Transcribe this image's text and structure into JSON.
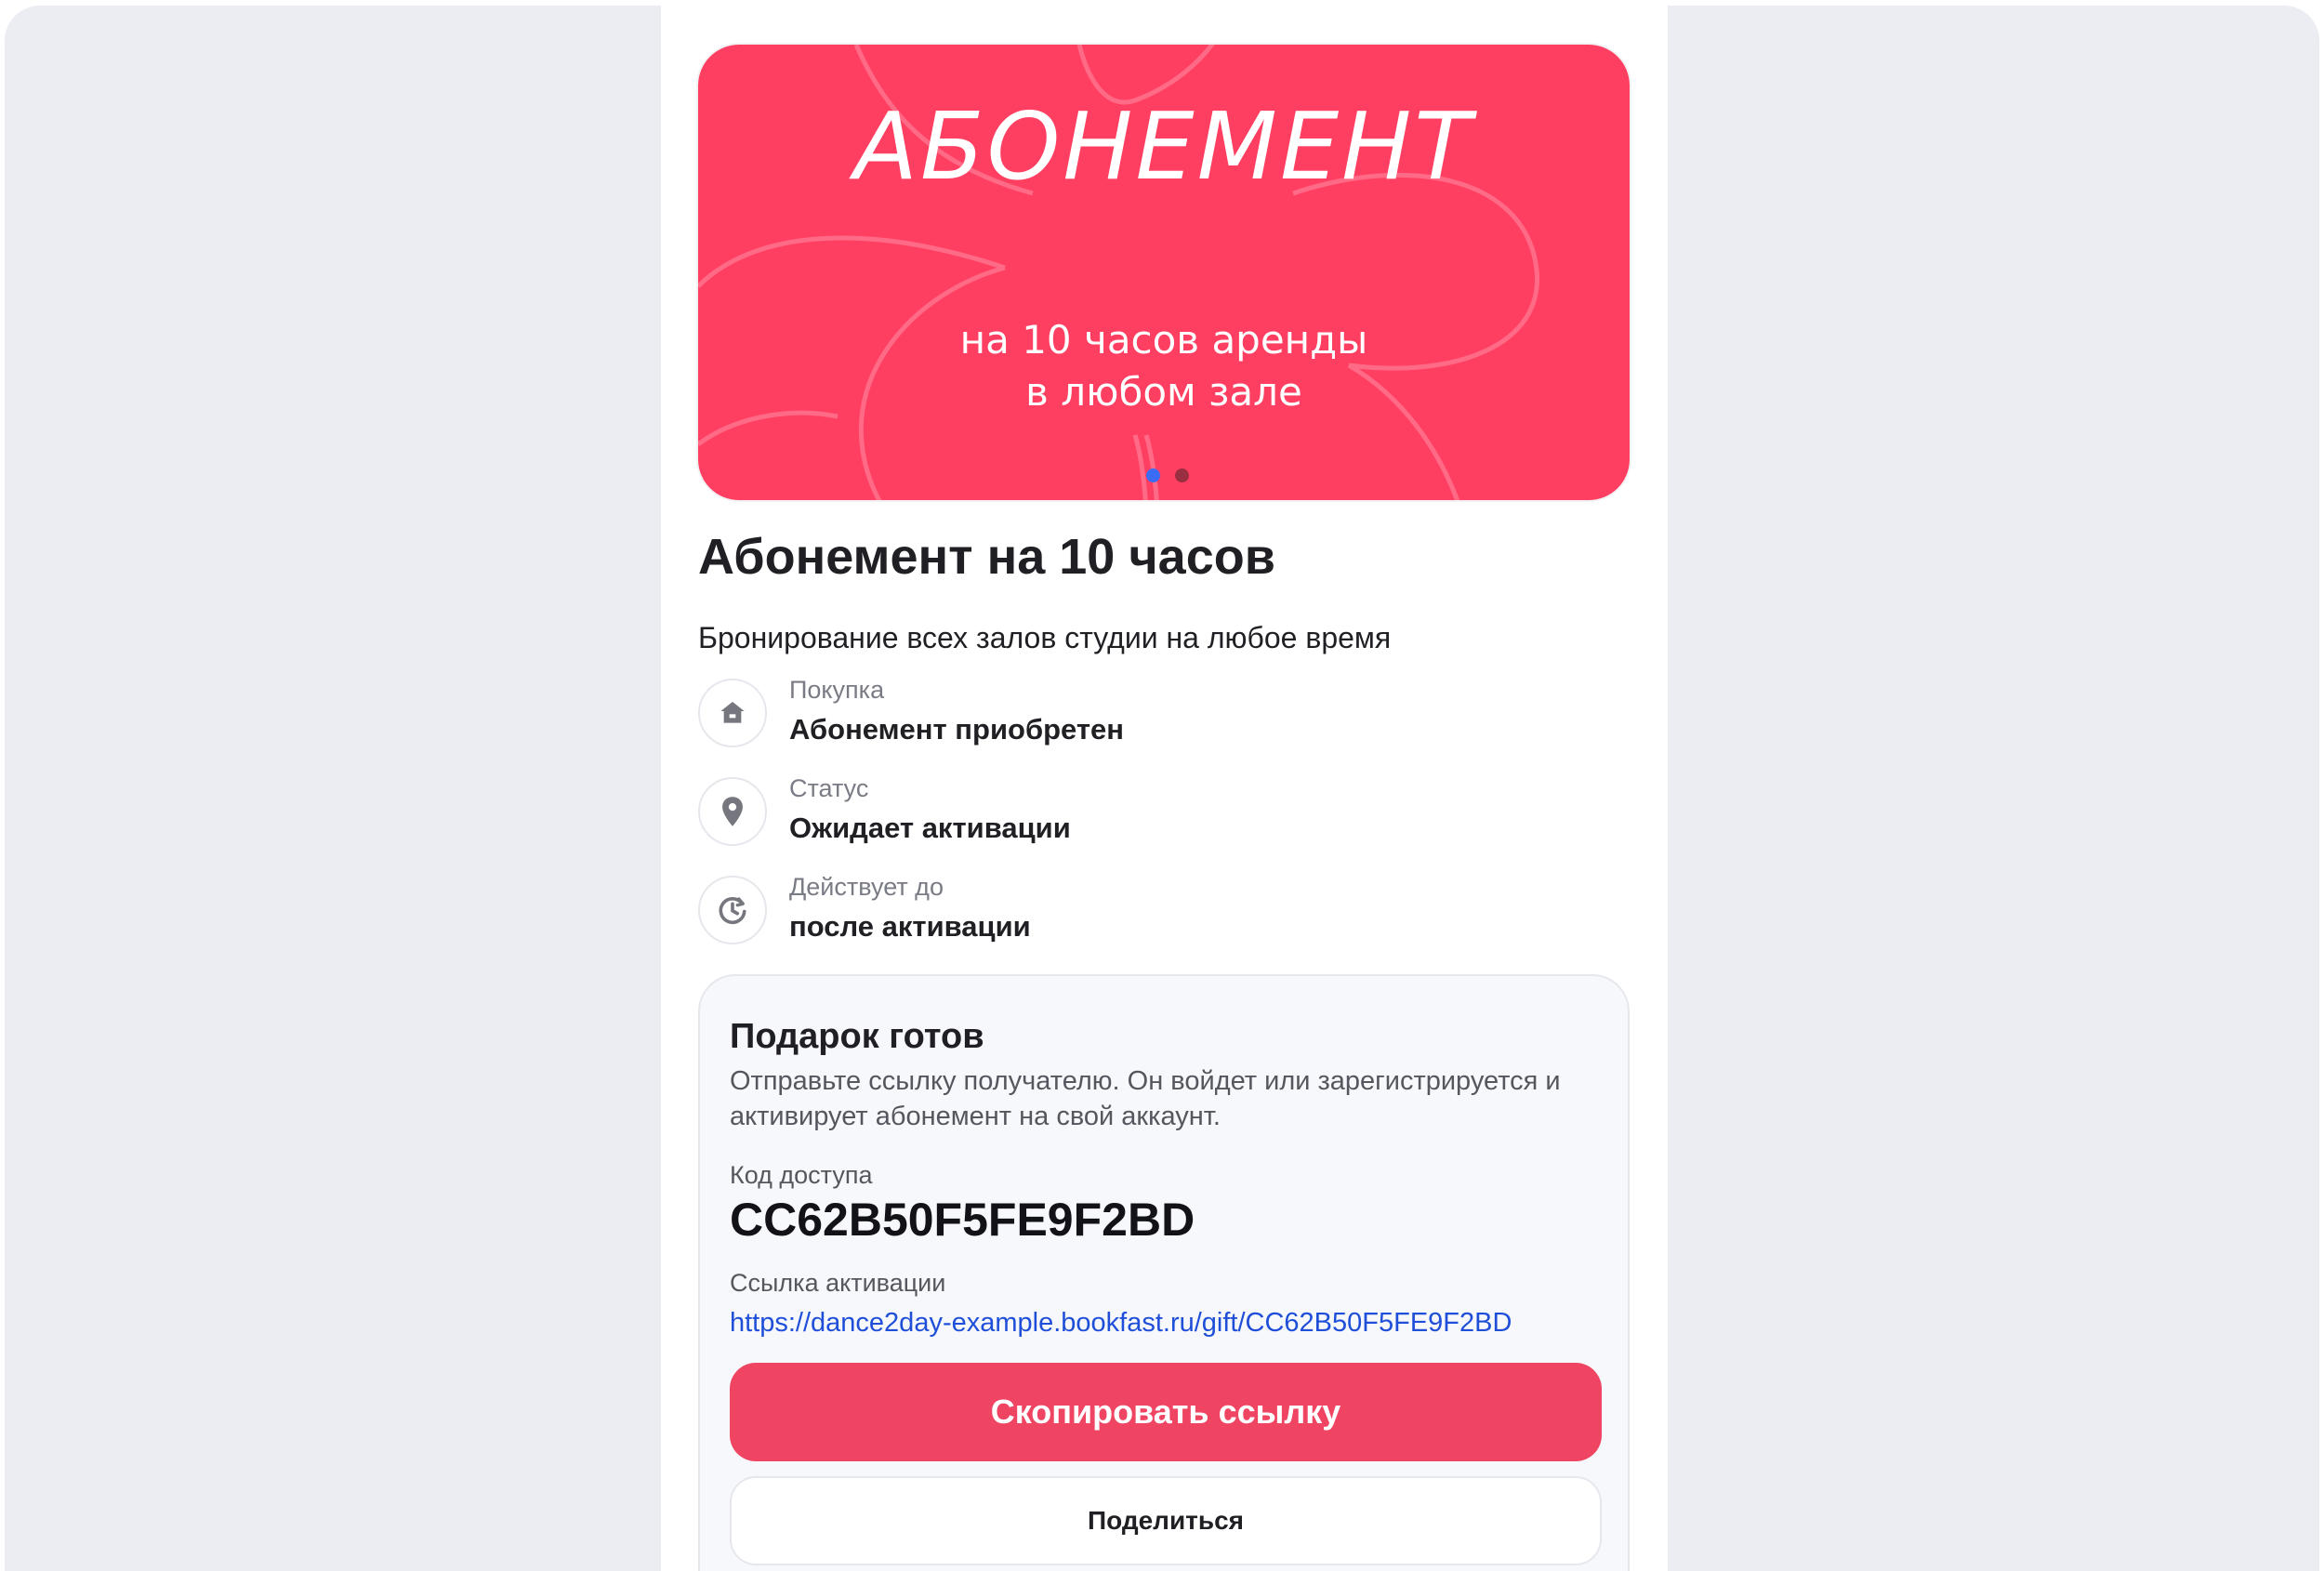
{
  "banner": {
    "title": "АБОНЕМЕНТ",
    "subtitle_line1": "на 10 часов аренды",
    "subtitle_line2": "в любом зале",
    "background_color": "#ff3f62",
    "slides_total": 2,
    "active_slide": 1,
    "dot_active_color": "#3a6cf6",
    "dot_inactive_color": "#9b2f42"
  },
  "product": {
    "title": "Абонемент на 10 часов",
    "description": "Бронирование всех залов студии на любое время"
  },
  "details": [
    {
      "icon": "house-icon",
      "label": "Покупка",
      "value": "Абонемент приобретен"
    },
    {
      "icon": "location-pin-icon",
      "label": "Статус",
      "value": "Ожидает активации"
    },
    {
      "icon": "moon-clock-icon",
      "label": "Действует до",
      "value": "после активации"
    }
  ],
  "gift": {
    "title": "Подарок готов",
    "text": "Отправьте ссылку получателю. Он войдет или зарегистрируется и активирует абонемент на свой аккаунт.",
    "code_label": "Код доступа",
    "code_value": "CC62B50F5FE9F2BD",
    "link_label": "Ссылка активации",
    "link_value": "https://dance2day-example.bookfast.ru/gift/CC62B50F5FE9F2BD",
    "copy_button": "Скопировать ссылку",
    "share_button": "Поделиться",
    "accent_color": "#f04463",
    "link_color": "#1f4fd8"
  }
}
